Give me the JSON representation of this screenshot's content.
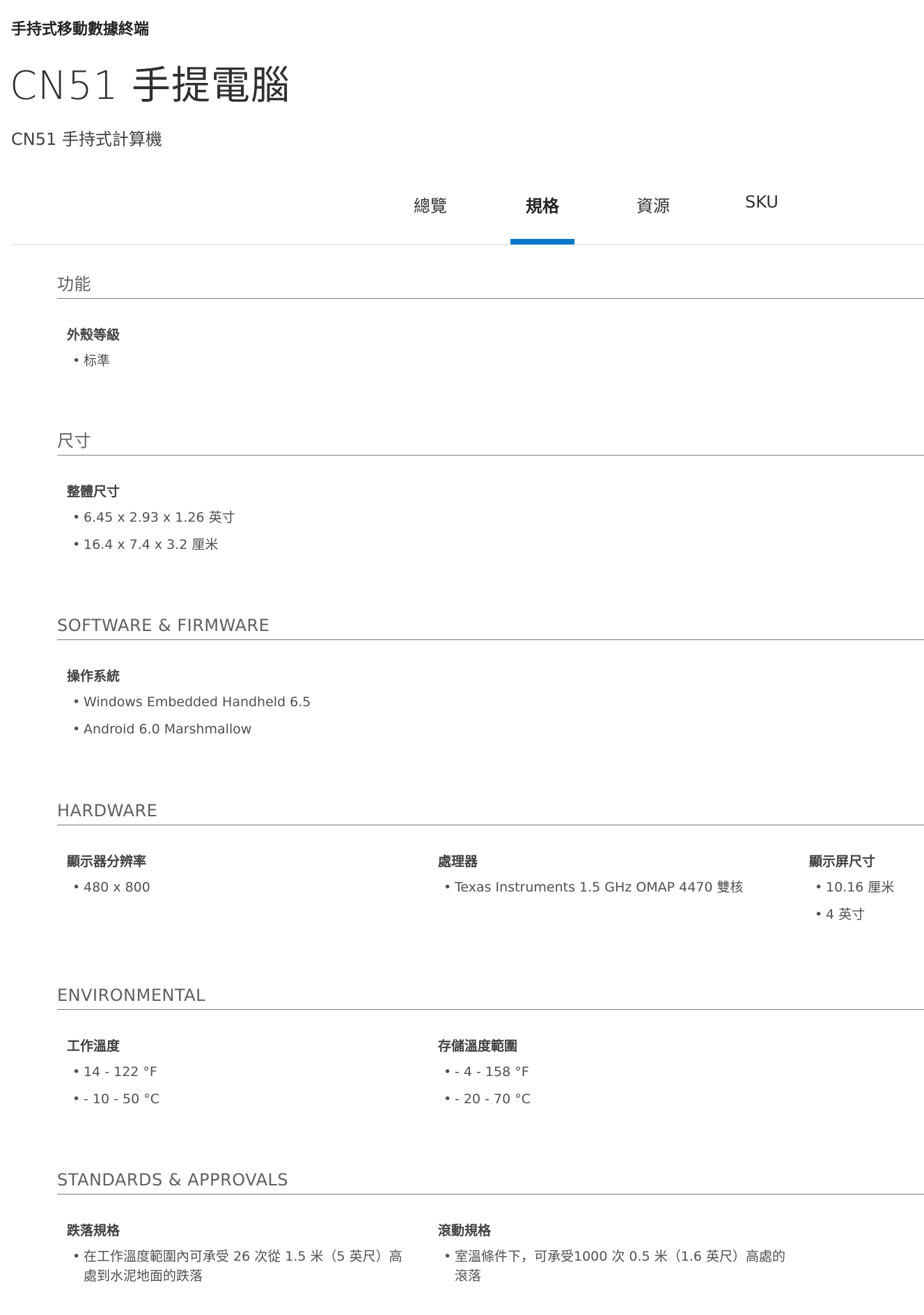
{
  "header": {
    "eyebrow": "手持式移動數據終端",
    "title": "CN51 手提電腦",
    "subtitle": "CN51 手持式計算機"
  },
  "tabs": [
    {
      "label": "總覽",
      "active": false
    },
    {
      "label": "規格",
      "active": true
    },
    {
      "label": "資源",
      "active": false
    },
    {
      "label": "SKU",
      "active": false
    }
  ],
  "accent_color": "#0a7ac8",
  "sections": [
    {
      "title": "功能",
      "groups": [
        {
          "label": "外殼等級",
          "items": [
            "标準"
          ]
        }
      ]
    },
    {
      "title": "尺寸",
      "groups": [
        {
          "label": "整體尺寸",
          "items": [
            "6.45 x 2.93 x 1.26 英寸",
            "16.4 x 7.4 x 3.2 厘米"
          ]
        }
      ]
    },
    {
      "title": "SOFTWARE & FIRMWARE",
      "groups": [
        {
          "label": "操作系統",
          "items": [
            "Windows Embedded Handheld 6.5",
            "Android 6.0 Marshmallow"
          ]
        }
      ]
    },
    {
      "title": "HARDWARE",
      "groups": [
        {
          "label": "顯示器分辨率",
          "items": [
            "480 x 800"
          ]
        },
        {
          "label": "處理器",
          "items": [
            "Texas Instruments 1.5 GHz OMAP 4470 雙核"
          ]
        },
        {
          "label": "顯示屏尺寸",
          "items": [
            "10.16 厘米",
            "4 英寸"
          ]
        }
      ]
    },
    {
      "title": "ENVIRONMENTAL",
      "groups": [
        {
          "label": "工作溫度",
          "items": [
            "14 - 122 °F",
            "- 10 - 50 °C"
          ]
        },
        {
          "label": "存儲溫度範圍",
          "items": [
            "- 4 - 158 °F",
            "- 20 - 70 °C"
          ]
        }
      ]
    },
    {
      "title": "STANDARDS & APPROVALS",
      "groups": [
        {
          "label": "跌落規格",
          "items": [
            "在工作溫度範圍內可承受 26 次從 1.5 米（5 英尺）高處到水泥地面的跌落"
          ]
        },
        {
          "label": "滾動規格",
          "items": [
            "室溫條件下，可承受1000 次 0.5 米（1.6 英尺）高處的滾落"
          ]
        }
      ]
    }
  ]
}
